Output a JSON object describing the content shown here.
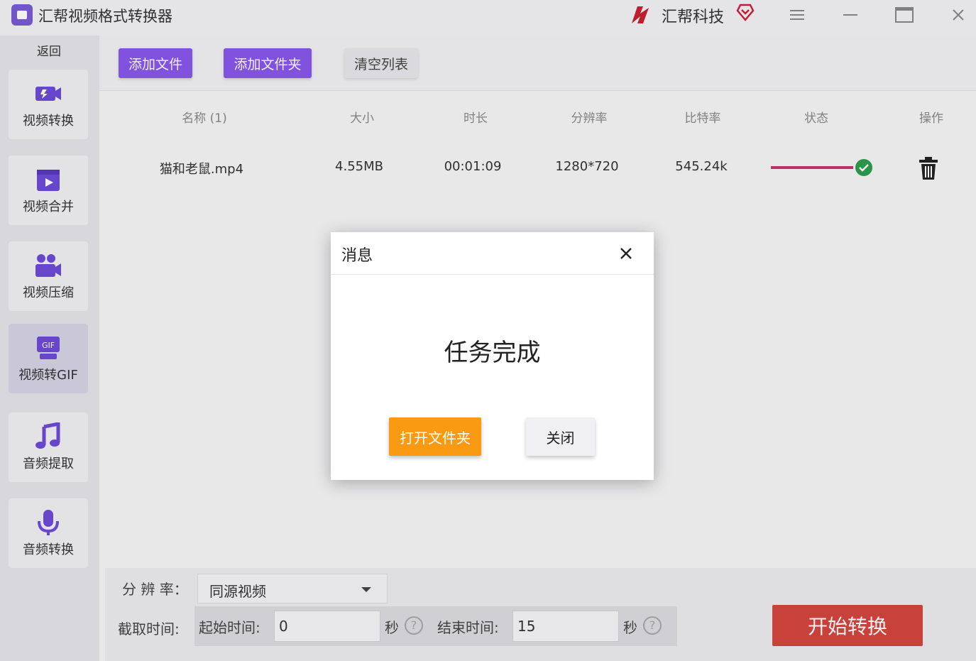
{
  "app": {
    "title": "汇帮视频格式转换器",
    "brand": "汇帮科技"
  },
  "sidebar": {
    "back_label": "返回",
    "items": [
      {
        "label": "视频转换",
        "icon": "video-convert-icon"
      },
      {
        "label": "视频合并",
        "icon": "video-merge-icon"
      },
      {
        "label": "视频压缩",
        "icon": "video-compress-icon"
      },
      {
        "label": "视频转GIF",
        "icon": "gif-icon"
      },
      {
        "label": "音频提取",
        "icon": "music-note-icon"
      },
      {
        "label": "音频转换",
        "icon": "microphone-icon"
      }
    ]
  },
  "toolbar": {
    "add_file": "添加文件",
    "add_folder": "添加文件夹",
    "clear_list": "清空列表"
  },
  "table": {
    "headers": {
      "name": "名称 (1)",
      "size": "大小",
      "duration": "时长",
      "resolution": "分辨率",
      "bitrate": "比特率",
      "status": "状态",
      "action": "操作"
    },
    "rows": [
      {
        "name": "猫和老鼠.mp4",
        "size": "4.55MB",
        "duration": "00:01:09",
        "resolution": "1280*720",
        "bitrate": "545.24k",
        "progress": 1.0
      }
    ]
  },
  "settings": {
    "resolution_label": "分 辨 率：",
    "resolution_value": "同源视频",
    "clip_label": "截取时间:",
    "start_label": "起始时间:",
    "start_value": "0",
    "start_unit": "秒",
    "end_label": "结束时间:",
    "end_value": "15",
    "end_unit": "秒",
    "help_glyph": "?",
    "start_button": "开始转换"
  },
  "dialog": {
    "title": "消息",
    "message": "任务完成",
    "open_folder": "打开文件夹",
    "close": "关闭"
  },
  "colors": {
    "accent_purple": "#8a58ec",
    "start_red": "#d6463f",
    "open_orange": "#fa9a13",
    "progress": "#c8346a",
    "success": "#2e9e4e"
  }
}
